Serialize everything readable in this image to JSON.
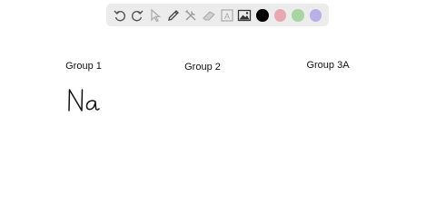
{
  "toolbar": {
    "tools": [
      {
        "id": "undo",
        "icon": "undo-icon"
      },
      {
        "id": "redo",
        "icon": "redo-icon"
      },
      {
        "id": "select",
        "icon": "pointer-icon"
      },
      {
        "id": "pen",
        "icon": "pencil-icon"
      },
      {
        "id": "tools",
        "icon": "tools-icon"
      },
      {
        "id": "eraser",
        "icon": "eraser-icon"
      },
      {
        "id": "text",
        "icon": "text-box-icon"
      },
      {
        "id": "image",
        "icon": "image-icon"
      }
    ],
    "colors": [
      "#000000",
      "#e8a8b2",
      "#a9d5a4",
      "#b8b0e6"
    ],
    "selected_color": "#000000"
  },
  "canvas": {
    "headings": [
      "Group 1",
      "Group 2",
      "Group 3A"
    ],
    "handwriting": "Na"
  }
}
